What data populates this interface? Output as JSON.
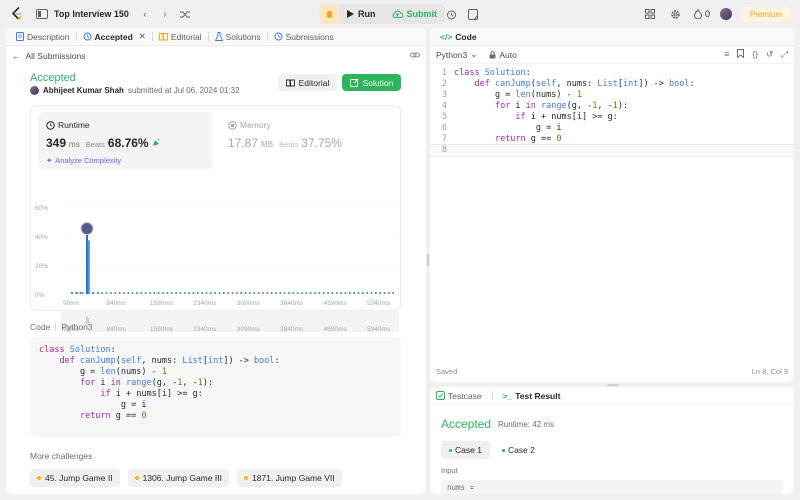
{
  "topbar": {
    "title": "Top Interview 150",
    "run_label": "Run",
    "submit_label": "Submit",
    "streak_count": "0",
    "premium_label": "Premium"
  },
  "left_tabs": [
    {
      "label": "Description"
    },
    {
      "label": "Accepted"
    },
    {
      "label": "Editorial"
    },
    {
      "label": "Solutions"
    },
    {
      "label": "Submissions"
    }
  ],
  "submission": {
    "back_label": "All Submissions",
    "status": "Accepted",
    "author": "Abhijeet Kumar Shah",
    "submitted_text": "submitted at Jul 06, 2024 01:32",
    "editorial_btn": "Editorial",
    "solution_btn": "Solution"
  },
  "runtime": {
    "label": "Runtime",
    "value": "349",
    "unit": "ms",
    "beats_label": "Beats",
    "beats_pct": "68.76%",
    "analyze_label": "Analyze Complexity"
  },
  "memory": {
    "label": "Memory",
    "value": "17.87",
    "unit": "MB",
    "beats_label": "Beats",
    "beats_pct": "37.75%"
  },
  "chart_data": {
    "type": "bar",
    "y_ticks": [
      "60%",
      "40%",
      "20%",
      "0%"
    ],
    "ylim": [
      0,
      60
    ],
    "x_ticks": [
      "90ms",
      "840ms",
      "1590ms",
      "2340ms",
      "3090ms",
      "3840ms",
      "4590ms",
      "5340ms"
    ],
    "bars": [
      {
        "x": 90,
        "y": 0.6
      },
      {
        "x": 180,
        "y": 0.6
      },
      {
        "x": 270,
        "y": 0.6
      },
      {
        "x": 349,
        "y": 41.0
      },
      {
        "x": 380,
        "y": 37.0
      },
      {
        "x": 450,
        "y": 0.6
      },
      {
        "x": 540,
        "y": 0.6
      }
    ],
    "highlight_x": 349,
    "xlim": [
      90,
      5650
    ]
  },
  "code_section": {
    "label": "Code",
    "lang": "Python3",
    "lines": [
      "class Solution:",
      "    def canJump(self, nums: List[int]) -> bool:",
      "        g = len(nums) - 1",
      "        for i in range(g, -1, -1):",
      "            if i + nums[i] >= g:",
      "                g = i",
      "        return g == 0"
    ]
  },
  "more": {
    "label": "More challenges",
    "items": [
      {
        "label": "45. Jump Game II"
      },
      {
        "label": "1306. Jump Game III"
      },
      {
        "label": "1871. Jump Game VII"
      }
    ]
  },
  "editor": {
    "title": "Code",
    "language": "Python3",
    "mode": "Auto",
    "saved": "Saved",
    "cursor": "Ln 8, Col 9",
    "line_numbers": [
      "1",
      "2",
      "3",
      "4",
      "5",
      "6",
      "7",
      "8"
    ]
  },
  "result": {
    "tab_testcase": "Testcase",
    "tab_result": "Test Result",
    "status": "Accepted",
    "runtime": "Runtime: 42 ms",
    "case1": "Case 1",
    "case2": "Case 2",
    "input_label": "Input",
    "input_value": "nums ="
  }
}
